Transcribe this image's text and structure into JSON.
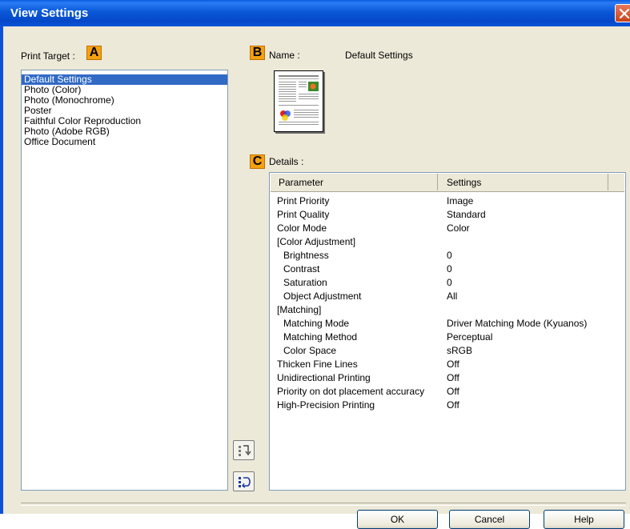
{
  "window": {
    "title": "View Settings"
  },
  "print_target": {
    "label": "Print Target :",
    "badge": "A",
    "items": [
      {
        "label": "Default Settings",
        "selected": true
      },
      {
        "label": "Photo (Color)"
      },
      {
        "label": "Photo (Monochrome)"
      },
      {
        "label": "Poster"
      },
      {
        "label": "Faithful Color Reproduction"
      },
      {
        "label": "Photo (Adobe RGB)"
      },
      {
        "label": "Office Document"
      }
    ]
  },
  "name_section": {
    "badge": "B",
    "label": "Name :",
    "value": "Default Settings"
  },
  "details": {
    "badge": "C",
    "label": "Details :",
    "columns": [
      "Parameter",
      "Settings"
    ],
    "rows": [
      {
        "param": "Print Priority",
        "setting": "Image"
      },
      {
        "param": "Print Quality",
        "setting": "Standard"
      },
      {
        "param": "Color Mode",
        "setting": "Color"
      },
      {
        "param": "[Color Adjustment]",
        "setting": ""
      },
      {
        "param": "Brightness",
        "setting": "0",
        "indent": true
      },
      {
        "param": "Contrast",
        "setting": "0",
        "indent": true
      },
      {
        "param": "Saturation",
        "setting": "0",
        "indent": true
      },
      {
        "param": "Object Adjustment",
        "setting": "All",
        "indent": true
      },
      {
        "param": "[Matching]",
        "setting": ""
      },
      {
        "param": "Matching Mode",
        "setting": "Driver Matching Mode (Kyuanos)",
        "indent": true
      },
      {
        "param": "Matching Method",
        "setting": "Perceptual",
        "indent": true
      },
      {
        "param": "Color Space",
        "setting": "sRGB",
        "indent": true
      },
      {
        "param": "Thicken Fine Lines",
        "setting": "Off"
      },
      {
        "param": "Unidirectional Printing",
        "setting": "Off"
      },
      {
        "param": "Priority on dot placement accuracy",
        "setting": "Off"
      },
      {
        "param": "High-Precision Printing",
        "setting": "Off"
      }
    ]
  },
  "buttons": {
    "ok": "OK",
    "cancel": "Cancel",
    "help": "Help"
  },
  "icons": {
    "close": "close-icon",
    "side_top": "export-settings-icon",
    "side_bottom": "import-settings-icon"
  },
  "colors": {
    "titlebar": "#0a58d8",
    "badge": "#f4a010",
    "selection": "#316ac5"
  }
}
